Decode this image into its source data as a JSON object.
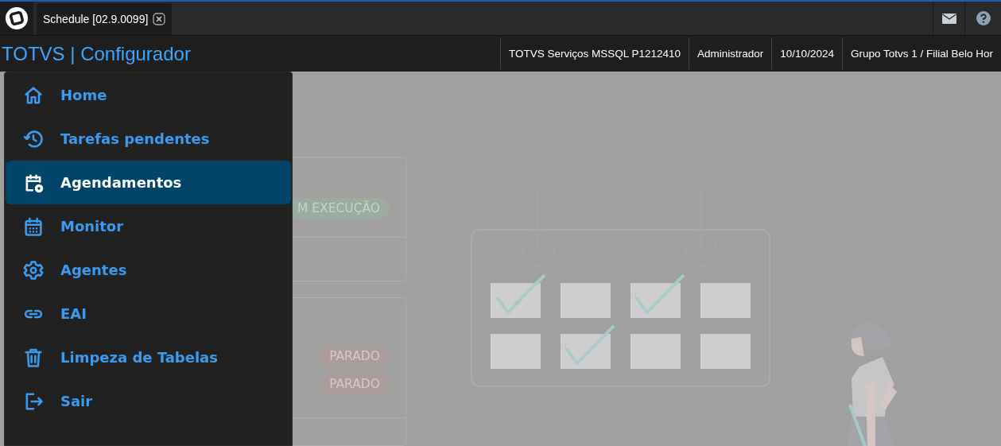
{
  "app_tab": {
    "title": "Schedule [02.9.0099]"
  },
  "header": {
    "title": "TOTVS | Configurador",
    "info": [
      "TOTVS Serviços MSSQL P1212410",
      "Administrador",
      "10/10/2024",
      "Grupo Totvs 1 / Filial Belo Hor"
    ]
  },
  "menu": {
    "items": [
      {
        "label": "Home",
        "kind": "home",
        "selected": false
      },
      {
        "label": "Tarefas pendentes",
        "kind": "history",
        "selected": false
      },
      {
        "label": "Agendamentos",
        "kind": "schedule",
        "selected": true
      },
      {
        "label": "Monitor",
        "kind": "calendar",
        "selected": false
      },
      {
        "label": "Agentes",
        "kind": "gear",
        "selected": false
      },
      {
        "label": "EAI",
        "kind": "link",
        "selected": false
      },
      {
        "label": "Limpeza de Tabelas",
        "kind": "trash",
        "selected": false
      },
      {
        "label": "Sair",
        "kind": "exit",
        "selected": false
      }
    ]
  },
  "background_cards": [
    {
      "badges": [
        {
          "label": "M EXECUÇÃO",
          "kind": "running"
        }
      ]
    },
    {
      "badges": [
        {
          "label": "PARADO",
          "kind": "stopped"
        },
        {
          "label": "PARADO",
          "kind": "stopped"
        }
      ]
    }
  ]
}
